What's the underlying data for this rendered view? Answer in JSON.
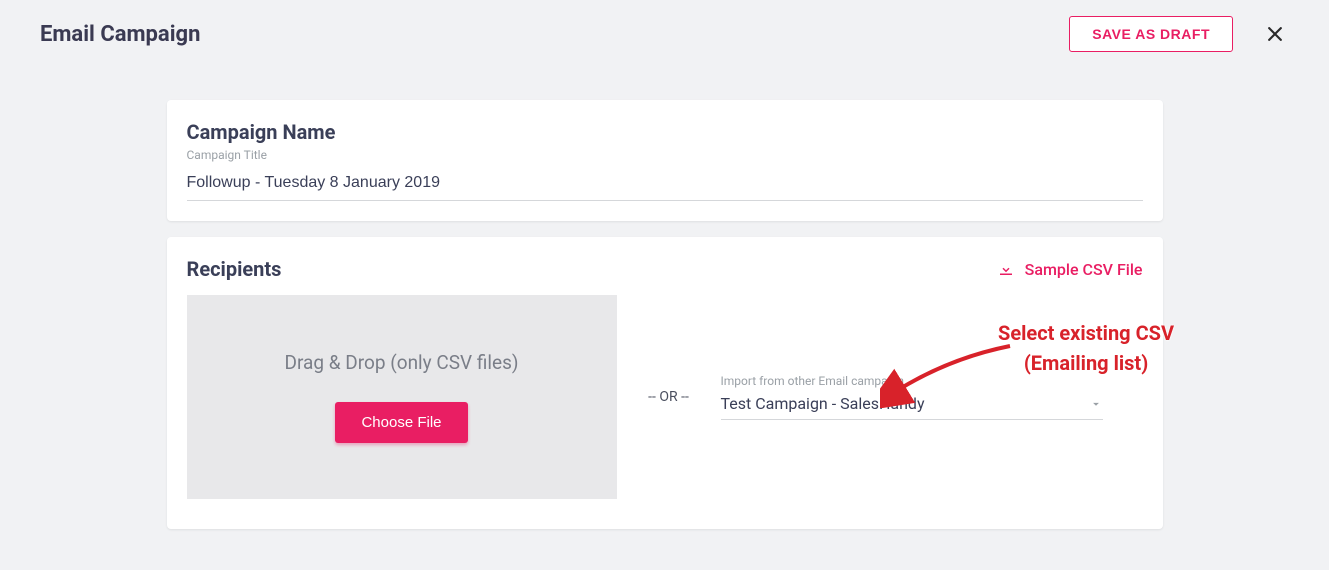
{
  "header": {
    "title": "Email Campaign",
    "save_draft_label": "SAVE AS DRAFT"
  },
  "campaign": {
    "heading": "Campaign Name",
    "title_label": "Campaign Title",
    "title_value": "Followup - Tuesday 8 January 2019"
  },
  "recipients": {
    "heading": "Recipients",
    "sample_csv_label": "Sample CSV File",
    "dropzone_text": "Drag & Drop (only CSV files)",
    "choose_file_label": "Choose File",
    "or_label": "-- OR --",
    "import_label": "Import from other Email campaign",
    "selected_campaign": "Test Campaign - SalesHandy"
  },
  "annotation": {
    "line1": "Select existing CSV",
    "line2": "(Emailing list)"
  },
  "colors": {
    "accent": "#e91e63",
    "annotation": "#d8222a"
  }
}
